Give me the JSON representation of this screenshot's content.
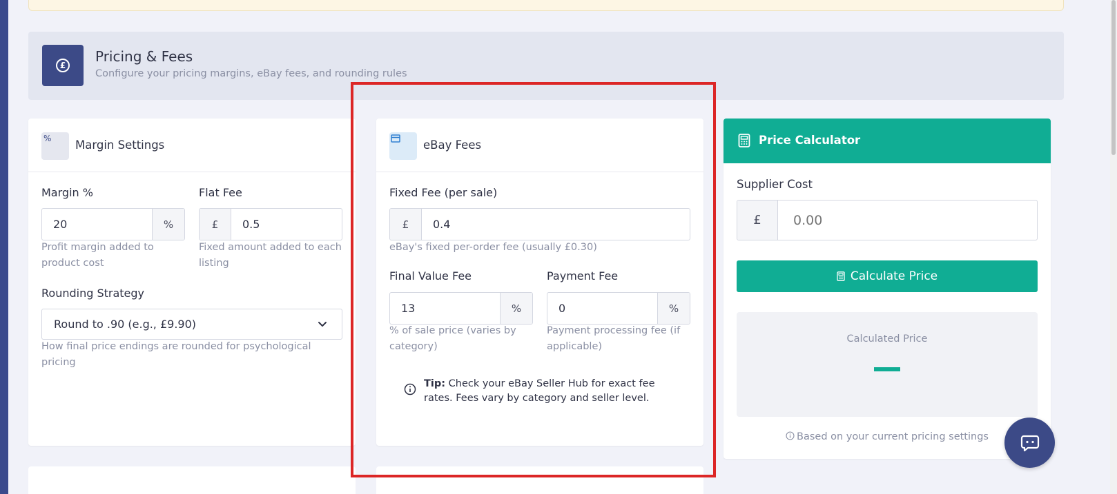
{
  "section": {
    "title": "Pricing & Fees",
    "subtitle": "Configure your pricing margins, eBay fees, and rounding rules",
    "icon": "pound-coin-icon"
  },
  "margin_card": {
    "title": "Margin Settings",
    "icon_glyph": "%",
    "margin_label": "Margin %",
    "margin_value": "20",
    "margin_suffix": "%",
    "margin_help": "Profit margin added to product cost",
    "flat_fee_label": "Flat Fee",
    "flat_fee_prefix": "£",
    "flat_fee_value": "0.5",
    "flat_fee_help": "Fixed amount added to each listing",
    "rounding_label": "Rounding Strategy",
    "rounding_value": "Round to .90 (e.g., £9.90)",
    "rounding_help": "How final price endings are rounded for psychological pricing"
  },
  "ebay_card": {
    "title": "eBay Fees",
    "fixed_fee_label": "Fixed Fee (per sale)",
    "fixed_fee_prefix": "£",
    "fixed_fee_value": "0.4",
    "fixed_fee_help": "eBay's fixed per-order fee (usually £0.30)",
    "fvf_label": "Final Value Fee",
    "fvf_value": "13",
    "fvf_suffix": "%",
    "fvf_help": "% of sale price (varies by category)",
    "payment_label": "Payment Fee",
    "payment_value": "0",
    "payment_suffix": "%",
    "payment_help": "Payment processing fee (if applicable)",
    "tip_bold": "Tip:",
    "tip_text": " Check your eBay Seller Hub for exact fee rates. Fees vary by category and seller level."
  },
  "calculator": {
    "title": "Price Calculator",
    "supplier_label": "Supplier Cost",
    "supplier_prefix": "£",
    "supplier_placeholder": "0.00",
    "button_label": "Calculate Price",
    "result_label": "Calculated Price",
    "footer_note": "Based on your current pricing settings"
  },
  "colors": {
    "accent": "#10ad94",
    "brand": "#3c4a87",
    "highlight": "#dc2626"
  }
}
